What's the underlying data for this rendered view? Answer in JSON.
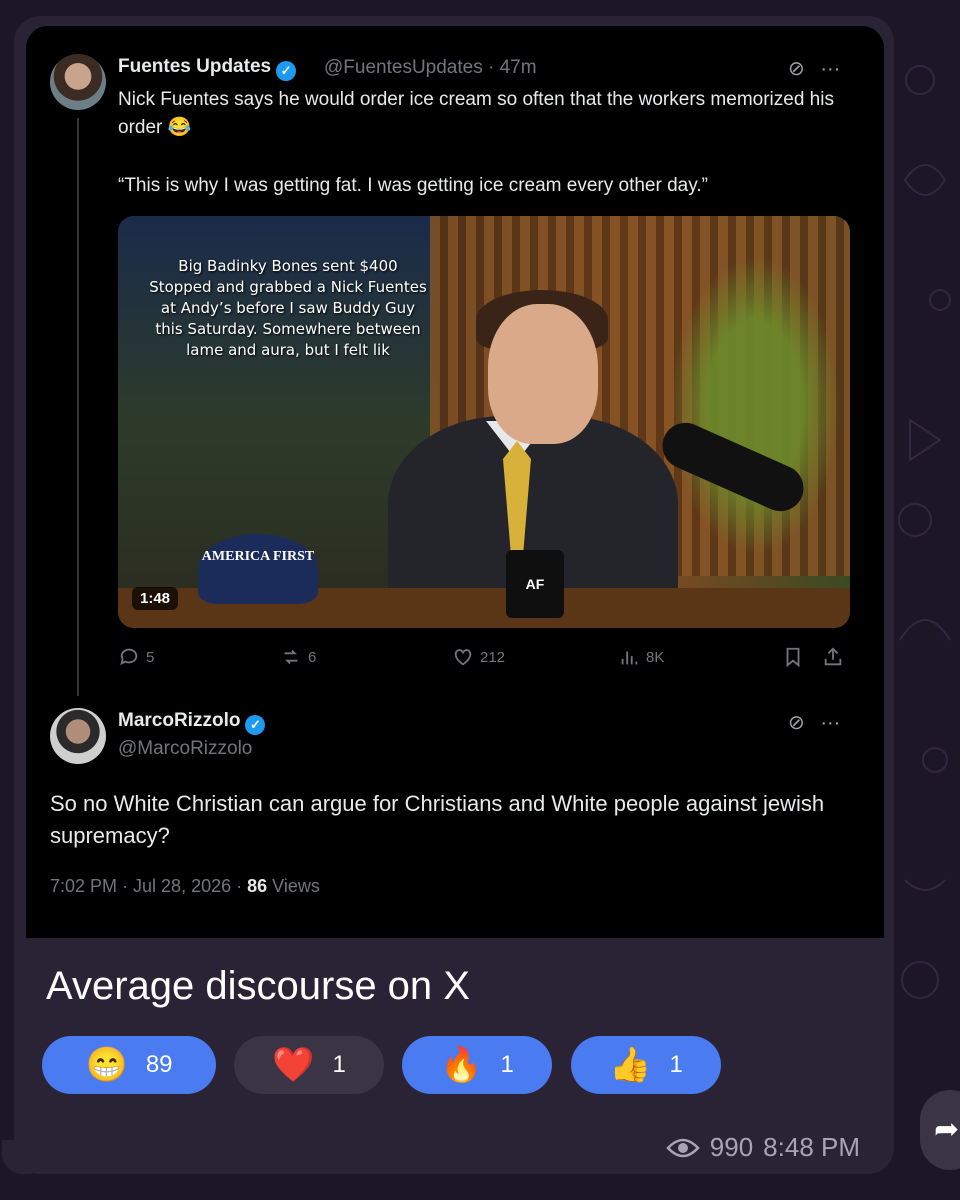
{
  "tweet1": {
    "name": "Fuentes Updates",
    "handle": "@FuentesUpdates",
    "time": "· 47m",
    "text": "Nick Fuentes says he would order ice cream so often that the workers memorized his order 😂",
    "quote": "“This is why I was getting fat. I was getting ice cream every other day.”",
    "media": {
      "overlay": "Big Badinky Bones sent $400 Stopped and grabbed a Nick Fuentes at Andy’s before I saw Buddy Guy this Saturday. Somewhere between lame and aura, but I felt lik",
      "hat_text": "AMERICA FIRST",
      "mug_text": "AF",
      "duration": "1:48"
    },
    "actions": {
      "replies": "5",
      "reposts": "6",
      "likes": "212",
      "views": "8K"
    }
  },
  "tweet2": {
    "name": "MarcoRizzolo",
    "handle": "@MarcoRizzolo",
    "text": "So no White Christian can argue for Christians and White people against jewish supremacy?",
    "time": "7:02 PM · Jul 28, 2026 ·",
    "views_count": "86",
    "views_label": "Views"
  },
  "message": {
    "caption": "Average discourse on X",
    "reactions": [
      {
        "emoji": "😁",
        "count": "89"
      },
      {
        "emoji": "❤️",
        "count": "1"
      },
      {
        "emoji": "🔥",
        "count": "1"
      },
      {
        "emoji": "👍",
        "count": "1"
      }
    ],
    "view_count": "990",
    "sent_time": "8:48 PM"
  },
  "icons": [
    "grok-icon",
    "more-icon",
    "reply-icon",
    "repost-icon",
    "like-icon",
    "views-icon",
    "bookmark-icon",
    "share-icon",
    "eye-icon",
    "forward-icon"
  ],
  "colors": {
    "accent": "#1d9bf0",
    "reaction_blue": "#4a7bf0",
    "bubble": "#2a2336",
    "card": "#000000"
  }
}
